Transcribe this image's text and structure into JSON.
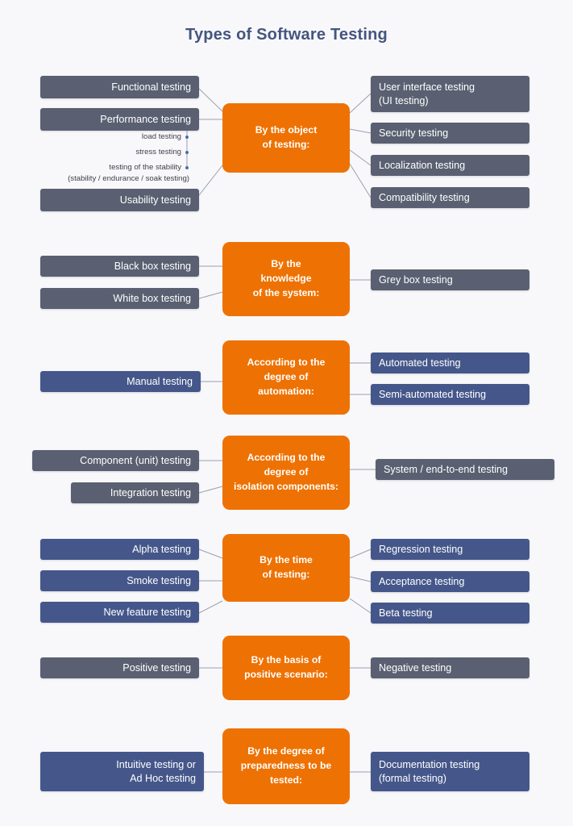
{
  "page": {
    "title": "Types of Software Testing",
    "background_color": "#f8f8fb",
    "title_color": "#44567f"
  },
  "colors": {
    "hub_orange": "#ee7203",
    "node_gray": "#5a6071",
    "node_blue": "#45578a",
    "connector": "#9aa0ad",
    "subdot": "#4a6fa8"
  },
  "sections": [
    {
      "hub": "By the object\nof testing:",
      "hub_lines": [
        "By the object",
        "of testing:"
      ],
      "left": [
        "Functional testing",
        "Performance testing",
        "Usability testing"
      ],
      "right": [
        "User interface testing (UI testing)",
        "Security testing",
        "Localization testing",
        "Compatibility testing"
      ],
      "right_lines": [
        [
          "User interface testing",
          "(UI testing)"
        ],
        [
          "Security testing"
        ],
        [
          "Localization testing"
        ],
        [
          "Compatibility testing"
        ]
      ],
      "subitems": [
        "load testing",
        "stress testing",
        "testing of the stability",
        "(stability / endurance / soak testing)"
      ]
    },
    {
      "hub": "By the knowledge of the system:",
      "hub_lines": [
        "By the",
        "knowledge",
        "of the system:"
      ],
      "left": [
        "Black box testing",
        "White box testing"
      ],
      "right": [
        "Grey box testing"
      ],
      "right_lines": [
        [
          "Grey box testing"
        ]
      ],
      "subitems": []
    },
    {
      "hub": "According to the degree of automation:",
      "hub_lines": [
        "According to the",
        "degree of",
        "automation:"
      ],
      "left": [
        "Manual testing"
      ],
      "right": [
        "Automated testing",
        "Semi-automated testing"
      ],
      "right_lines": [
        [
          "Automated testing"
        ],
        [
          "Semi-automated testing"
        ]
      ],
      "subitems": []
    },
    {
      "hub": "According to the degree of isolation components:",
      "hub_lines": [
        "According to the",
        "degree of",
        "isolation components:"
      ],
      "left": [
        "Component (unit) testing",
        "Integration testing"
      ],
      "right": [
        "System / end-to-end testing"
      ],
      "right_lines": [
        [
          "System / end-to-end testing"
        ]
      ],
      "subitems": []
    },
    {
      "hub": "By the time of testing:",
      "hub_lines": [
        "By the time",
        "of testing:"
      ],
      "left": [
        "Alpha testing",
        "Smoke testing",
        "New feature testing"
      ],
      "right": [
        "Regression testing",
        "Acceptance testing",
        "Beta testing"
      ],
      "right_lines": [
        [
          "Regression testing"
        ],
        [
          "Acceptance testing"
        ],
        [
          "Beta testing"
        ]
      ],
      "subitems": []
    },
    {
      "hub": "By the basis of positive scenario:",
      "hub_lines": [
        "By the basis of",
        "positive scenario:"
      ],
      "left": [
        "Positive testing"
      ],
      "right": [
        "Negative testing"
      ],
      "right_lines": [
        [
          "Negative testing"
        ]
      ],
      "subitems": []
    },
    {
      "hub": "By the degree of preparedness to be tested:",
      "hub_lines": [
        "By the degree of",
        "preparedness to be",
        "tested:"
      ],
      "left": [
        "Intuitive testing or Ad Hoc testing"
      ],
      "left_lines": [
        [
          "Intuitive testing or",
          "Ad Hoc testing"
        ]
      ],
      "right": [
        "Documentation testing (formal testing)"
      ],
      "right_lines": [
        [
          "Documentation testing",
          "(formal testing)"
        ]
      ],
      "subitems": []
    }
  ]
}
